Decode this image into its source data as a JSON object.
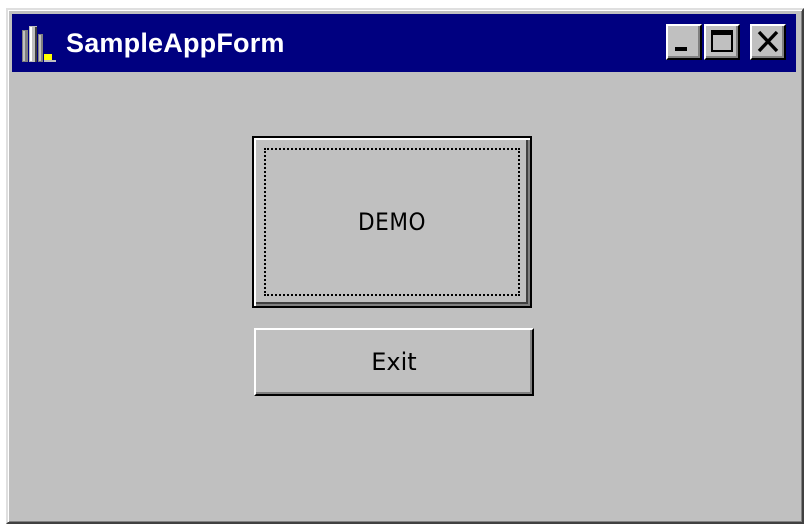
{
  "window": {
    "title": "SampleAppForm",
    "title_bar_color": "#000080",
    "face_color": "#c0c0c0",
    "app_icon": "app-icon",
    "controls": [
      {
        "name": "minimize",
        "icon": "minimize-icon"
      },
      {
        "name": "maximize",
        "icon": "maximize-icon"
      },
      {
        "name": "close",
        "icon": "close-icon"
      }
    ]
  },
  "form": {
    "demo_button_label": "DEMO",
    "exit_button_label": "Exit",
    "focused_button": "DEMO"
  }
}
